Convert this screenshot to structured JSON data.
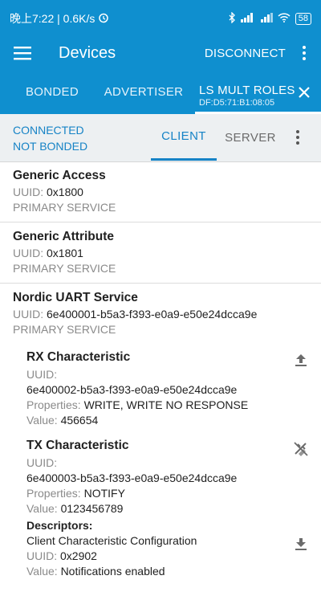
{
  "status_bar": {
    "left_text": "晚上7:22 | 0.6K/s",
    "alarm_icon": "alarm-icon",
    "right_icons": [
      "bluetooth-icon",
      "signal-icon",
      "hd-signal-icon",
      "wifi-icon"
    ],
    "battery": "58"
  },
  "app_bar": {
    "title": "Devices",
    "disconnect_label": "DISCONNECT"
  },
  "tabs": {
    "bonded": "BONDED",
    "advertiser": "ADVERTISER",
    "active_title": "LS MULT ROLES",
    "active_address": "DF:D5:71:B1:08:05"
  },
  "connection": {
    "state": "CONNECTED",
    "bond_state": "NOT BONDED",
    "client_tab": "CLIENT",
    "server_tab": "SERVER"
  },
  "labels": {
    "uuid": "UUID:",
    "properties": "Properties:",
    "value": "Value:",
    "descriptors": "Descriptors:"
  },
  "services": [
    {
      "name": "Generic Access",
      "uuid": "0x1800",
      "type": "PRIMARY SERVICE"
    },
    {
      "name": "Generic Attribute",
      "uuid": "0x1801",
      "type": "PRIMARY SERVICE"
    },
    {
      "name": "Nordic UART Service",
      "uuid": "6e400001-b5a3-f393-e0a9-e50e24dcca9e",
      "type": "PRIMARY SERVICE"
    }
  ],
  "characteristics": [
    {
      "name": "RX Characteristic",
      "uuid": "6e400002-b5a3-f393-e0a9-e50e24dcca9e",
      "properties": "WRITE, WRITE NO RESPONSE",
      "value": "456654",
      "action_icon": "upload-icon"
    },
    {
      "name": "TX Characteristic",
      "uuid": "6e400003-b5a3-f393-e0a9-e50e24dcca9e",
      "properties": "NOTIFY",
      "value": "0123456789",
      "action_icon": "notifications-toggle-icon",
      "descriptor": {
        "name": "Client Characteristic Configuration",
        "uuid": "0x2902",
        "value": "Notifications enabled",
        "action_icon": "download-icon"
      }
    }
  ],
  "colors": {
    "primary": "#0f8fcf",
    "accent": "#1683c6",
    "subbar_bg": "#edf0f2"
  }
}
